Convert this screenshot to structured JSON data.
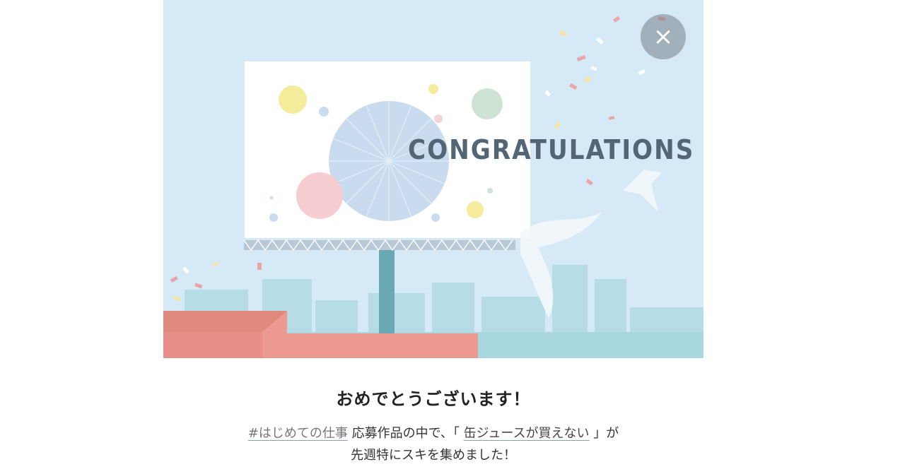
{
  "banner": {
    "headline": "CONGRATULATIONS"
  },
  "close": {
    "glyph": "×",
    "icon": "close-icon"
  },
  "message": {
    "title": "おめでとうございます！",
    "hashtag": "#はじめての仕事",
    "line1_middle": " 応募作品の中で、「 ",
    "article_title": "缶ジュースが買えない",
    "line1_end": " 」が",
    "line2": "先週特にスキを集めました！"
  },
  "colors": {
    "sky": "#d6e9f6",
    "billboard": "#ffffff",
    "roof": "#e89087",
    "city": "#a9d7e0",
    "headline": "#536675"
  }
}
